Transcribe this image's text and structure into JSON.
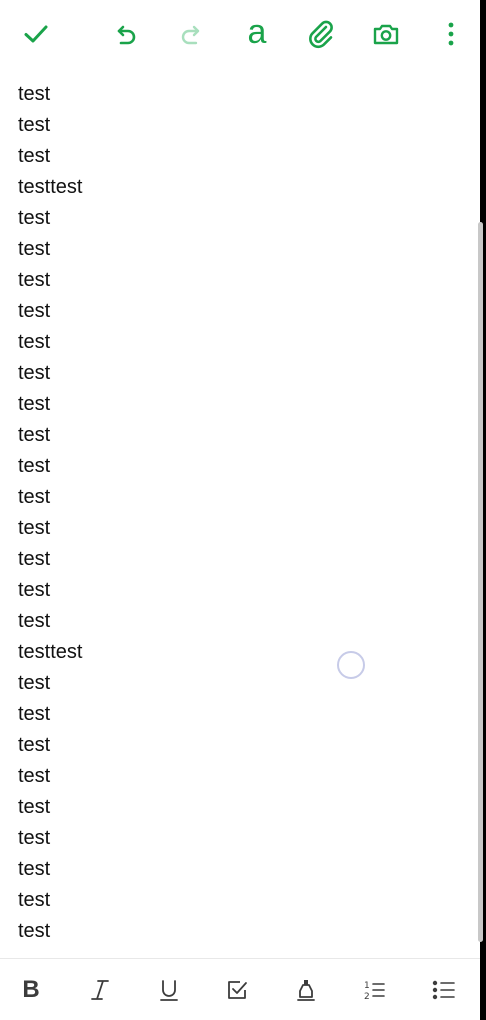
{
  "colors": {
    "accent": "#1aa34a",
    "accent_disabled": "#a8dfbd",
    "text": "#111111",
    "toolbar_icon": "#3c3c3c"
  },
  "top_toolbar": {
    "done_icon": "checkmark-icon",
    "undo_icon": "undo-icon",
    "redo_icon": "redo-icon",
    "font_label": "a",
    "attach_icon": "paperclip-icon",
    "camera_icon": "camera-icon",
    "more_icon": "more-vertical-icon"
  },
  "editor": {
    "lines": [
      "test",
      "test",
      "test",
      "testtest",
      "test",
      "test",
      "test",
      "test",
      "test",
      "test",
      "test",
      "test",
      "test",
      "test",
      "test",
      "test",
      "test",
      "test",
      "testtest",
      "test",
      "test",
      "test",
      "test",
      "test",
      "test",
      "test",
      "test",
      "test"
    ]
  },
  "format_toolbar": {
    "bold_label": "B",
    "italic_icon": "italic-icon",
    "underline_icon": "underline-icon",
    "checkbox_icon": "checkbox-icon",
    "highlight_icon": "highlighter-icon",
    "numbered_list_icon": "numbered-list-icon",
    "bullet_list_icon": "bullet-list-icon"
  }
}
